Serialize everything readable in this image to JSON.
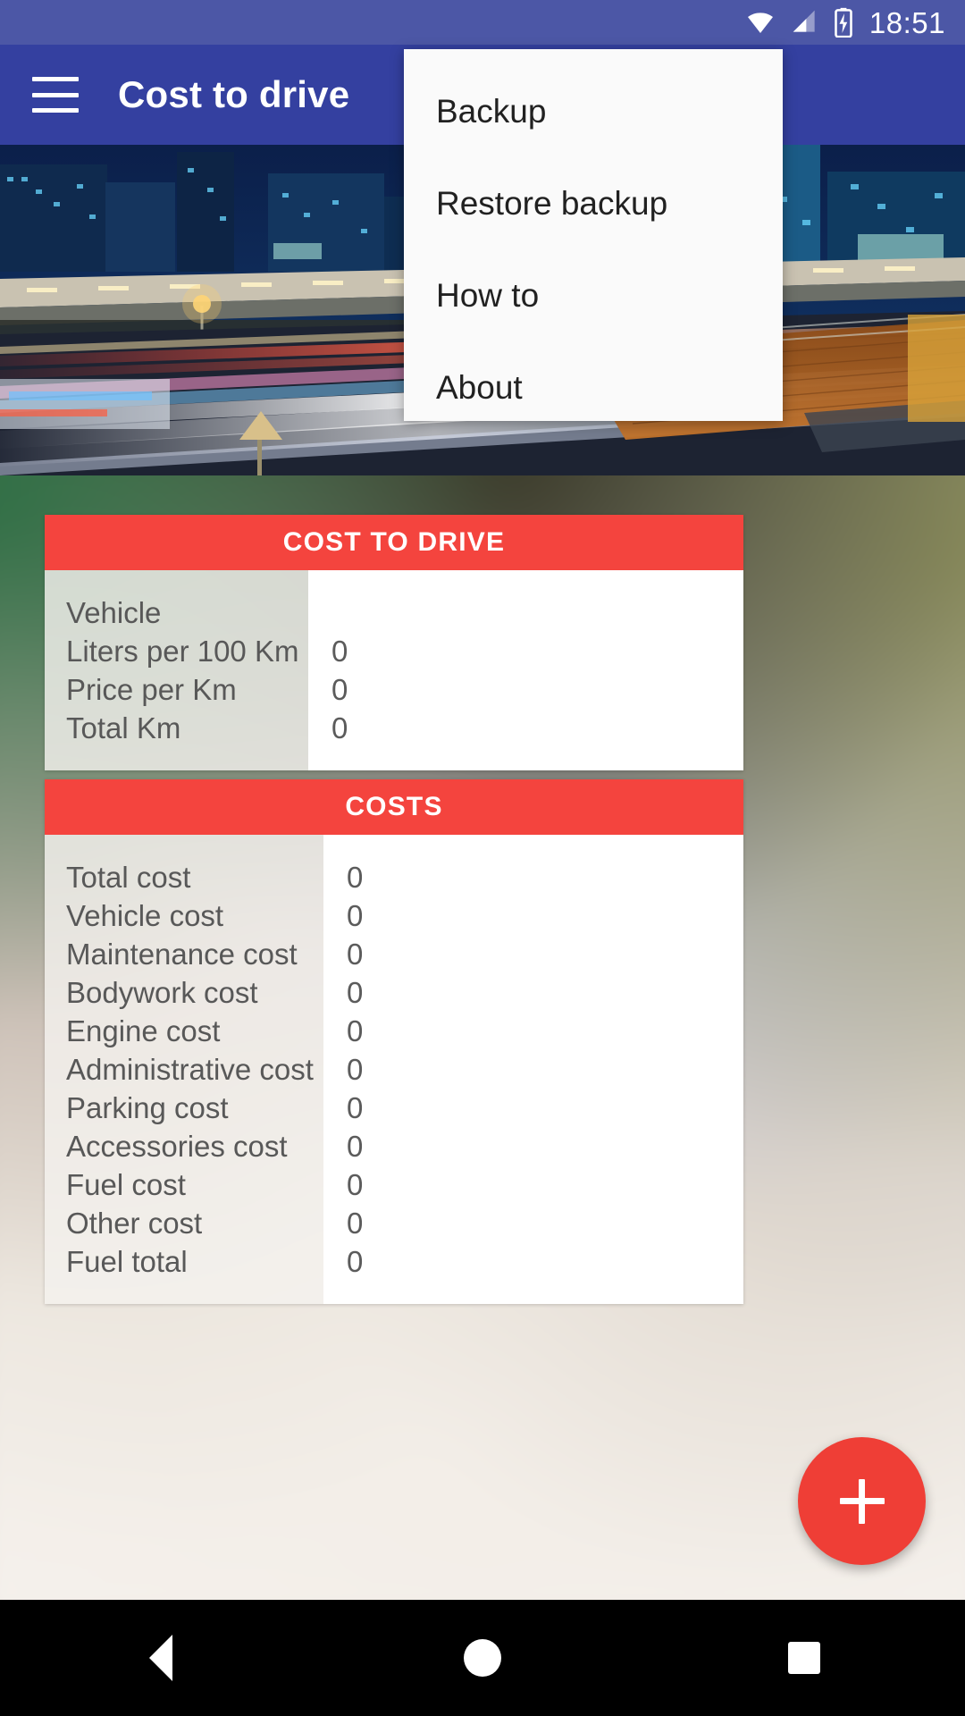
{
  "status_bar": {
    "time": "18:51",
    "icons": [
      "wifi-icon",
      "cellular-signal-icon",
      "battery-charging-icon"
    ]
  },
  "app_bar": {
    "title": "Cost to drive",
    "menu_icon": "hamburger-menu-icon"
  },
  "overflow_menu": {
    "items": [
      {
        "label": "Backup"
      },
      {
        "label": "Restore backup"
      },
      {
        "label": "How to"
      },
      {
        "label": "About"
      }
    ]
  },
  "hero": {
    "alt": "night city highway light trails"
  },
  "cards": [
    {
      "title": "COST TO DRIVE",
      "rows": [
        {
          "label": "Vehicle",
          "value": ""
        },
        {
          "label": "Liters per 100 Km",
          "value": "0"
        },
        {
          "label": "Price per Km",
          "value": "0"
        },
        {
          "label": "Total Km",
          "value": "0"
        }
      ]
    },
    {
      "title": "COSTS",
      "rows": [
        {
          "label": "Total cost",
          "value": "0"
        },
        {
          "label": "Vehicle cost",
          "value": "0"
        },
        {
          "label": "Maintenance cost",
          "value": "0"
        },
        {
          "label": "Bodywork cost",
          "value": "0"
        },
        {
          "label": "Engine cost",
          "value": "0"
        },
        {
          "label": "Administrative cost",
          "value": "0"
        },
        {
          "label": "Parking cost",
          "value": "0"
        },
        {
          "label": "Accessories cost",
          "value": "0"
        },
        {
          "label": "Fuel cost",
          "value": "0"
        },
        {
          "label": "Other cost",
          "value": "0"
        },
        {
          "label": "Fuel total",
          "value": "0"
        }
      ]
    }
  ],
  "fab": {
    "icon": "plus-icon",
    "label": "+"
  },
  "nav_bar": {
    "back": "back-triangle-icon",
    "home": "home-circle-icon",
    "recents": "recents-square-icon"
  },
  "colors": {
    "app_bar": "#3440a0",
    "status_bar": "#4c57a6",
    "accent_red": "#f4443e",
    "fab_red": "#ef3e36",
    "menu_bg": "#fafafa",
    "nav_bar": "#000000"
  }
}
